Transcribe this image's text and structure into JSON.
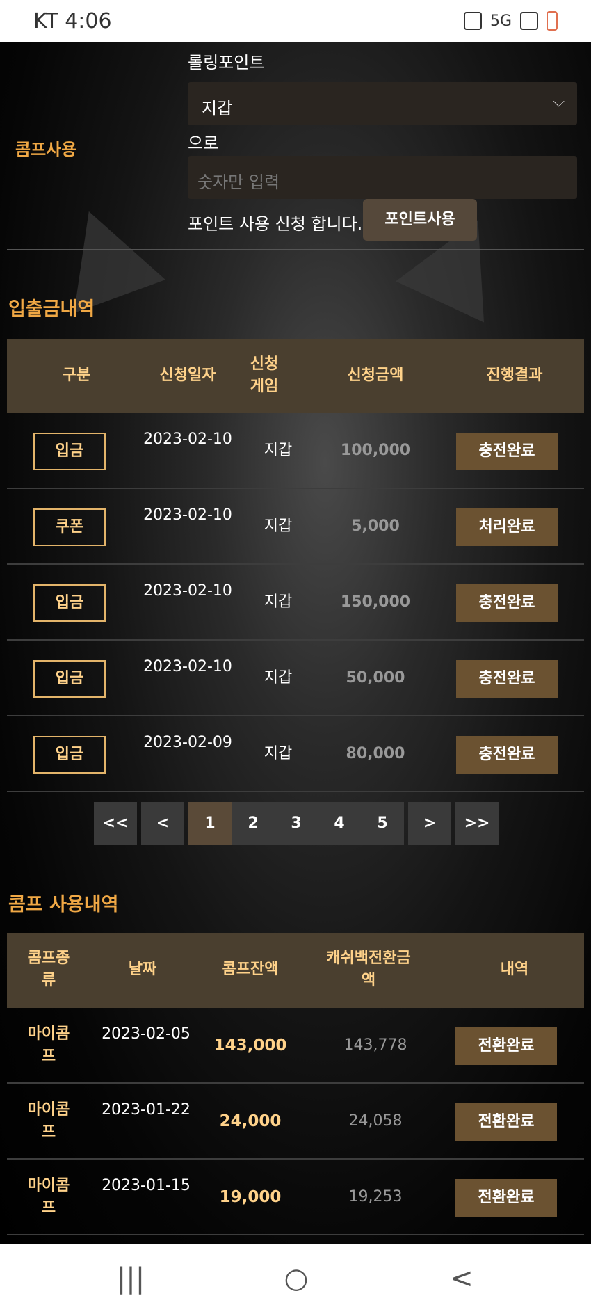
{
  "status_bar": {
    "carrier_time": "KT 4:06",
    "network": "5G"
  },
  "comp_use": {
    "label": "콤프사용",
    "rolling_label": "롤링포인트",
    "wallet_select": "지갑",
    "euro_label": "으로",
    "amount_placeholder": "숫자만 입력",
    "request_text": "포인트 사용 신청 합니다.",
    "point_button": "포인트사용"
  },
  "deposit_history": {
    "title": "입출금내역",
    "headers": [
      "구분",
      "신청일자",
      "신청게임",
      "신청금액",
      "진행결과"
    ],
    "rows": [
      {
        "type": "입금",
        "date": "2023-02-10",
        "game": "지갑",
        "amount": "100,000",
        "result": "충전완료"
      },
      {
        "type": "쿠폰",
        "date": "2023-02-10",
        "game": "지갑",
        "amount": "5,000",
        "result": "처리완료"
      },
      {
        "type": "입금",
        "date": "2023-02-10",
        "game": "지갑",
        "amount": "150,000",
        "result": "충전완료"
      },
      {
        "type": "입금",
        "date": "2023-02-10",
        "game": "지갑",
        "amount": "50,000",
        "result": "충전완료"
      },
      {
        "type": "입금",
        "date": "2023-02-09",
        "game": "지갑",
        "amount": "80,000",
        "result": "충전완료"
      }
    ]
  },
  "pagination": {
    "first": "<<",
    "prev": "<",
    "pages": [
      "1",
      "2",
      "3",
      "4",
      "5"
    ],
    "next": ">",
    "last": ">>",
    "current": "1"
  },
  "comp_history": {
    "title": "콤프 사용내역",
    "headers": [
      "콤프종류",
      "날짜",
      "콤프잔액",
      "캐쉬백전환금액",
      "내역"
    ],
    "rows": [
      {
        "kind": "마이콤프",
        "date": "2023-02-05",
        "balance": "143,000",
        "cashback": "143,778",
        "detail": "전환완료"
      },
      {
        "kind": "마이콤프",
        "date": "2023-01-22",
        "balance": "24,000",
        "cashback": "24,058",
        "detail": "전환완료"
      },
      {
        "kind": "마이콤프",
        "date": "2023-01-15",
        "balance": "19,000",
        "cashback": "19,253",
        "detail": "전환완료"
      }
    ]
  },
  "nav": {
    "recent": "|||",
    "home": "○",
    "back": "<"
  }
}
